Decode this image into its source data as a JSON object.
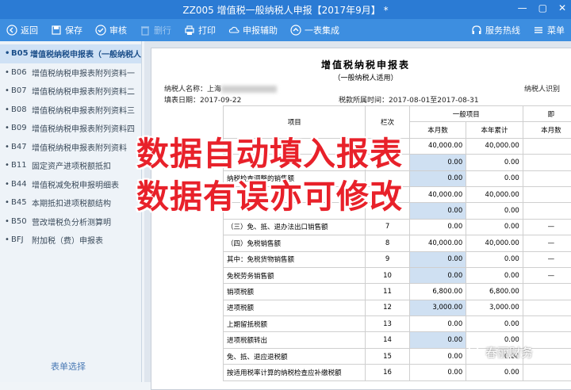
{
  "window": {
    "title": "ZZ005 增值税一般纳税人申报【2017年9月】 *"
  },
  "toolbar": {
    "back": "返回",
    "save": "保存",
    "audit": "审核",
    "delete": "删行",
    "print": "打印",
    "assist": "申报辅助",
    "integrate": "一表集成",
    "hotline": "服务热线",
    "menu": "菜单"
  },
  "sidebar": {
    "items": [
      {
        "code": "B05",
        "label": "增值税纳税申报表（一般纳税人"
      },
      {
        "code": "B06",
        "label": "增值税纳税申报表附列资料一"
      },
      {
        "code": "B07",
        "label": "增值税纳税申报表附列资料二"
      },
      {
        "code": "B08",
        "label": "增值税纳税申报表附列资料三"
      },
      {
        "code": "B09",
        "label": "增值税纳税申报表附列资料四"
      },
      {
        "code": "B47",
        "label": "增值税纳税申报表附列资料"
      },
      {
        "code": "B11",
        "label": "固定资产进项税额抵扣"
      },
      {
        "code": "B44",
        "label": "增值税减免税申报明细表"
      },
      {
        "code": "B45",
        "label": "本期抵扣进项税额结构"
      },
      {
        "code": "B50",
        "label": "营改增税负分析测算明"
      },
      {
        "code": "BFJ",
        "label": "附加税（费）申报表"
      }
    ],
    "footer": "表单选择"
  },
  "report": {
    "title": "增值税纳税申报表",
    "subtitle": "（一般纳税人适用）",
    "taxpayer_label": "纳税人名称：上海",
    "taxpayer_id_label": "纳税人识别",
    "fill_date": "填表日期：2017-09-22",
    "period": "税款所属时间：2017-08-01至2017-08-31",
    "col_item": "项目",
    "col_row": "栏次",
    "col_general": "一般项目",
    "col_month": "本月数",
    "col_year": "本年累计",
    "col_month2": "本月数",
    "col_extra": "即",
    "rows": [
      {
        "item": "",
        "no": "",
        "m": "40,000.00",
        "y": "40,000.00",
        "m2": "",
        "ed": false,
        "dash": false
      },
      {
        "item": "",
        "no": "",
        "m": "0.00",
        "y": "0.00",
        "m2": "",
        "ed": true,
        "dash": false
      },
      {
        "item": "纳税检查调整的销售额",
        "no": "",
        "m": "0.00",
        "y": "0.00",
        "m2": "",
        "ed": true,
        "dash": false
      },
      {
        "item": "",
        "no": "",
        "m": "40,000.00",
        "y": "40,000.00",
        "m2": "",
        "ed": false,
        "dash": false
      },
      {
        "item": "",
        "no": "",
        "m": "0.00",
        "y": "0.00",
        "m2": "",
        "ed": true,
        "dash": false
      },
      {
        "item": "（三）免、抵、退办法出口销售额",
        "no": "7",
        "m": "0.00",
        "y": "0.00",
        "m2": "—",
        "ed": false,
        "dash": true
      },
      {
        "item": "（四）免税销售额",
        "no": "8",
        "m": "40,000.00",
        "y": "40,000.00",
        "m2": "—",
        "ed": false,
        "dash": true
      },
      {
        "item": "其中：免税货物销售额",
        "no": "9",
        "m": "0.00",
        "y": "0.00",
        "m2": "—",
        "ed": true,
        "dash": true
      },
      {
        "item": "免税劳务销售额",
        "no": "10",
        "m": "0.00",
        "y": "0.00",
        "m2": "—",
        "ed": true,
        "dash": true
      },
      {
        "item": "销项税额",
        "no": "11",
        "m": "6,800.00",
        "y": "6,800.00",
        "m2": "",
        "ed": false,
        "dash": false
      },
      {
        "item": "进项税额",
        "no": "12",
        "m": "3,000.00",
        "y": "3,000.00",
        "m2": "",
        "ed": true,
        "dash": false
      },
      {
        "item": "上期留抵税额",
        "no": "13",
        "m": "0.00",
        "y": "0.00",
        "m2": "",
        "ed": false,
        "dash": false
      },
      {
        "item": "进项税额转出",
        "no": "14",
        "m": "0.00",
        "y": "0.00",
        "m2": "",
        "ed": true,
        "dash": false
      },
      {
        "item": "免、抵、退应退税额",
        "no": "15",
        "m": "0.00",
        "y": "0.00",
        "m2": "",
        "ed": false,
        "dash": false
      },
      {
        "item": "按适用税率计算的纳税检查应补缴税额",
        "no": "16",
        "m": "0.00",
        "y": "0.00",
        "m2": "",
        "ed": false,
        "dash": false
      }
    ]
  },
  "overlay": {
    "line1": "数据自动填入报表",
    "line2": "数据有误亦可修改"
  },
  "watermark": {
    "text": "春丽财务"
  }
}
